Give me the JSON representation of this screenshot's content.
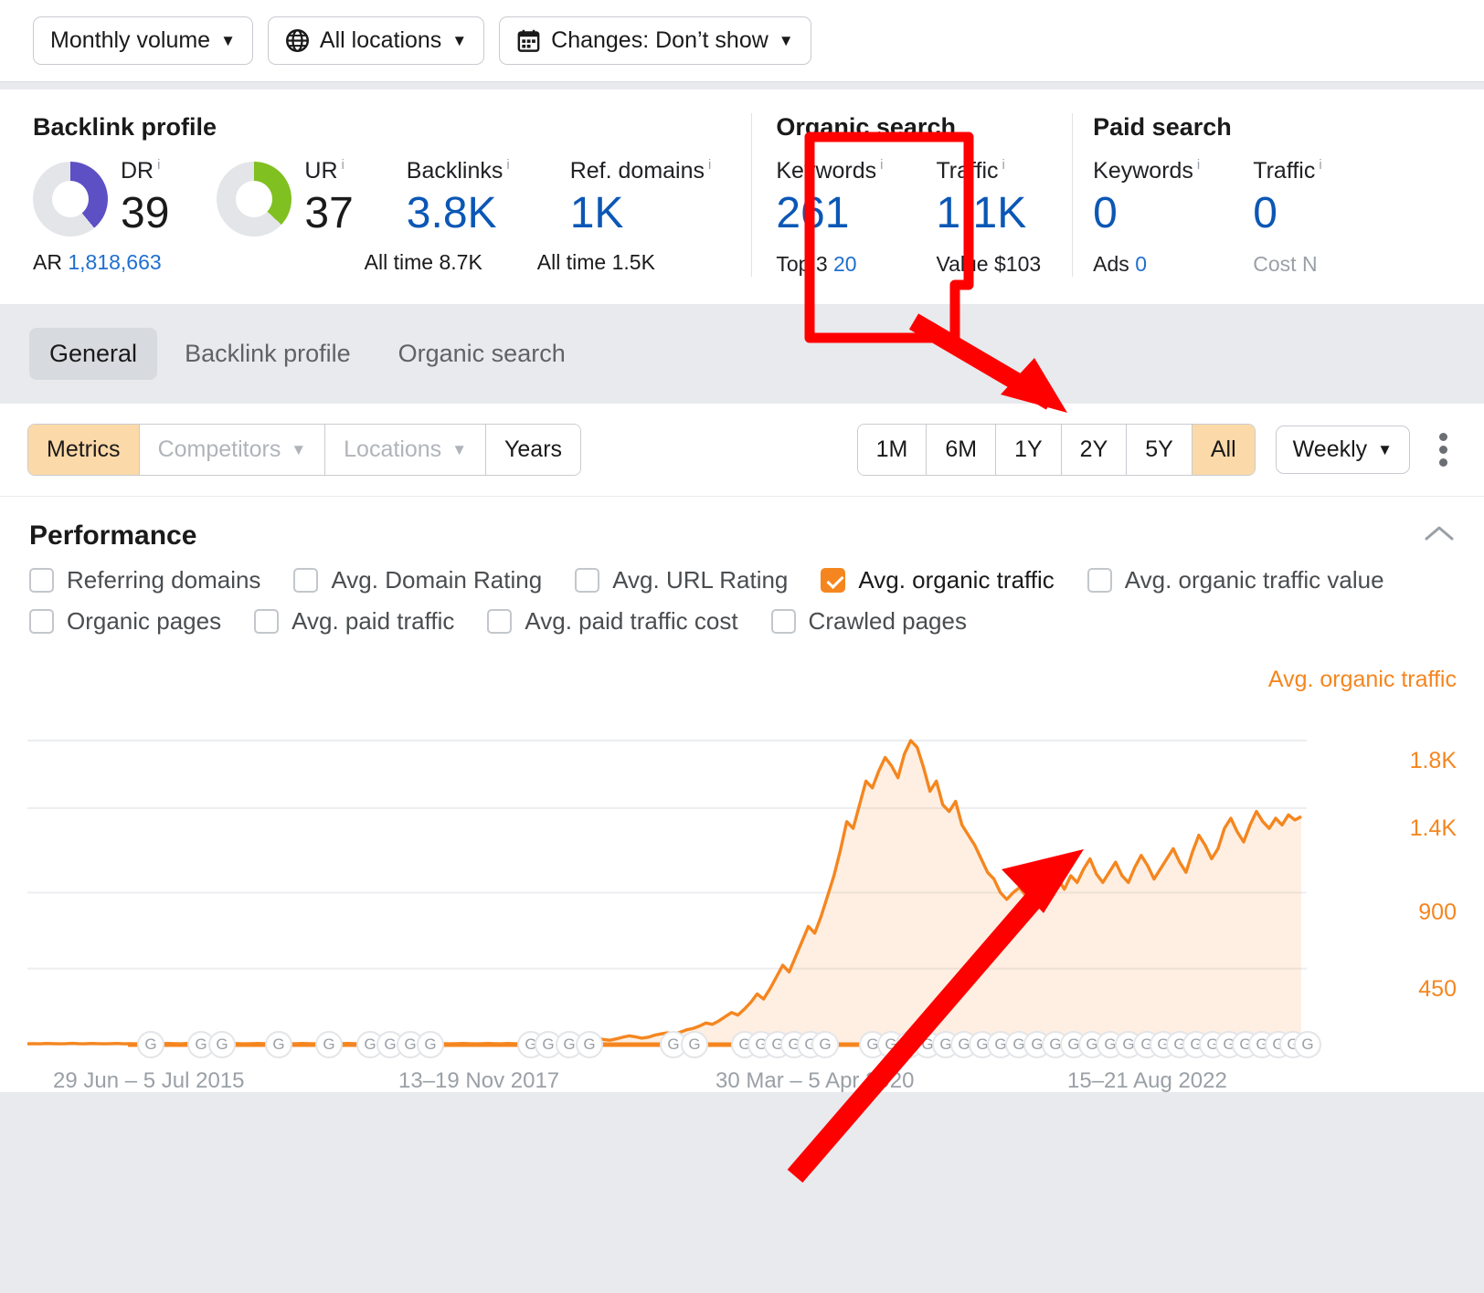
{
  "toolbar": {
    "volume": {
      "label": "Monthly volume",
      "icon": "chevron-down-icon"
    },
    "locations": {
      "label": "All locations",
      "icon": "globe-icon"
    },
    "changes": {
      "label": "Changes: Don’t show",
      "icon": "calendar-icon"
    }
  },
  "metrics": {
    "backlink_profile": {
      "title": "Backlink profile",
      "dr": {
        "label": "DR",
        "value": "39",
        "percent": 39,
        "color": "#5d4fc4"
      },
      "ur": {
        "label": "UR",
        "value": "37",
        "percent": 37,
        "color": "#80c020"
      },
      "ar": {
        "label": "AR",
        "value": "1,818,663"
      },
      "backlinks": {
        "label": "Backlinks",
        "value": "3.8K",
        "sub_label": "All time",
        "sub_value": "8.7K"
      },
      "ref_domains": {
        "label": "Ref. domains",
        "value": "1K",
        "sub_label": "All time",
        "sub_value": "1.5K"
      }
    },
    "organic_search": {
      "title": "Organic search",
      "keywords": {
        "label": "Keywords",
        "value": "261",
        "sub_label": "Top 3",
        "sub_value": "20"
      },
      "traffic": {
        "label": "Traffic",
        "value": "1.1K",
        "sub_label": "Value",
        "sub_value": "$103"
      }
    },
    "paid_search": {
      "title": "Paid search",
      "keywords": {
        "label": "Keywords",
        "value": "0",
        "sub_label": "Ads",
        "sub_value": "0"
      },
      "traffic": {
        "label": "Traffic",
        "value": "0",
        "sub_label": "Cost",
        "sub_value": "N"
      }
    }
  },
  "tabs": [
    {
      "label": "General",
      "active": true
    },
    {
      "label": "Backlink profile",
      "active": false
    },
    {
      "label": "Organic search",
      "active": false
    }
  ],
  "controls": {
    "left_segments": [
      {
        "label": "Metrics",
        "state": "selected",
        "caret": false
      },
      {
        "label": "Competitors",
        "state": "disabled",
        "caret": true
      },
      {
        "label": "Locations",
        "state": "disabled",
        "caret": true
      },
      {
        "label": "Years",
        "state": "normal",
        "caret": false
      }
    ],
    "ranges": [
      {
        "label": "1M",
        "selected": false
      },
      {
        "label": "6M",
        "selected": false
      },
      {
        "label": "1Y",
        "selected": false
      },
      {
        "label": "2Y",
        "selected": false
      },
      {
        "label": "5Y",
        "selected": false
      },
      {
        "label": "All",
        "selected": true
      }
    ],
    "granularity": {
      "label": "Weekly"
    },
    "more_menu": "kebab-menu-icon"
  },
  "performance": {
    "title": "Performance",
    "collapse_icon": "chevron-up-icon",
    "checkbox_rows": [
      [
        {
          "label": "Referring domains",
          "checked": false
        },
        {
          "label": "Avg. Domain Rating",
          "checked": false
        },
        {
          "label": "Avg. URL Rating",
          "checked": false
        },
        {
          "label": "Avg. organic traffic",
          "checked": true
        },
        {
          "label": "Avg. organic traffic value",
          "checked": false
        }
      ],
      [
        {
          "label": "Organic pages",
          "checked": false
        },
        {
          "label": "Avg. paid traffic",
          "checked": false
        },
        {
          "label": "Avg. paid traffic cost",
          "checked": false
        },
        {
          "label": "Crawled pages",
          "checked": false
        }
      ]
    ]
  },
  "chart_data": {
    "type": "area",
    "title": "Performance",
    "series_label": "Avg. organic traffic",
    "xlabel": "",
    "ylabel": "Avg. organic traffic",
    "ylim": [
      0,
      2000
    ],
    "yticks": [
      "1.8K",
      "1.4K",
      "900",
      "450"
    ],
    "ytick_values": [
      1800,
      1400,
      900,
      450
    ],
    "grid": true,
    "legend_position": "top-right",
    "line_color": "#f5861f",
    "fill_color": "rgba(245,134,31,0.13)",
    "xticks": [
      "29 Jun – 5 Jul 2015",
      "13–19 Nov 2017",
      "30 Mar – 5 Apr 2020",
      "15–21 Aug 2022"
    ],
    "annotation_marker": "G",
    "values": [
      5,
      6,
      5,
      7,
      6,
      5,
      6,
      8,
      6,
      5,
      7,
      6,
      5,
      6,
      7,
      5,
      6,
      5,
      7,
      6,
      5,
      6,
      7,
      6,
      5,
      7,
      6,
      5,
      6,
      7,
      5,
      6,
      7,
      6,
      5,
      6,
      7,
      6,
      5,
      7,
      6,
      5,
      6,
      7,
      6,
      5,
      7,
      6,
      5,
      6,
      7,
      6,
      5,
      6,
      7,
      5,
      6,
      7,
      6,
      5,
      6,
      7,
      6,
      5,
      7,
      6,
      5,
      6,
      7,
      6,
      5,
      6,
      7,
      6,
      5,
      7,
      6,
      5,
      6,
      7,
      8,
      10,
      14,
      20,
      28,
      36,
      30,
      34,
      42,
      38,
      30,
      26,
      34,
      44,
      52,
      46,
      38,
      44,
      56,
      64,
      70,
      62,
      74,
      88,
      96,
      110,
      128,
      120,
      140,
      165,
      190,
      175,
      210,
      250,
      300,
      270,
      330,
      400,
      470,
      430,
      520,
      610,
      700,
      660,
      760,
      880,
      1000,
      1150,
      1320,
      1280,
      1420,
      1560,
      1520,
      1620,
      1700,
      1650,
      1580,
      1720,
      1800,
      1760,
      1640,
      1500,
      1560,
      1420,
      1380,
      1440,
      1300,
      1240,
      1180,
      1100,
      1020,
      980,
      900,
      860,
      900,
      930,
      880,
      920,
      960,
      900,
      940,
      980,
      920,
      1000,
      960,
      1040,
      1100,
      1010,
      960,
      1020,
      1080,
      1000,
      960,
      1050,
      1120,
      1060,
      980,
      1040,
      1100,
      1160,
      1080,
      1020,
      1140,
      1240,
      1180,
      1100,
      1160,
      1280,
      1340,
      1260,
      1200,
      1300,
      1380,
      1320,
      1280,
      1340,
      1300,
      1360,
      1330,
      1350
    ]
  }
}
